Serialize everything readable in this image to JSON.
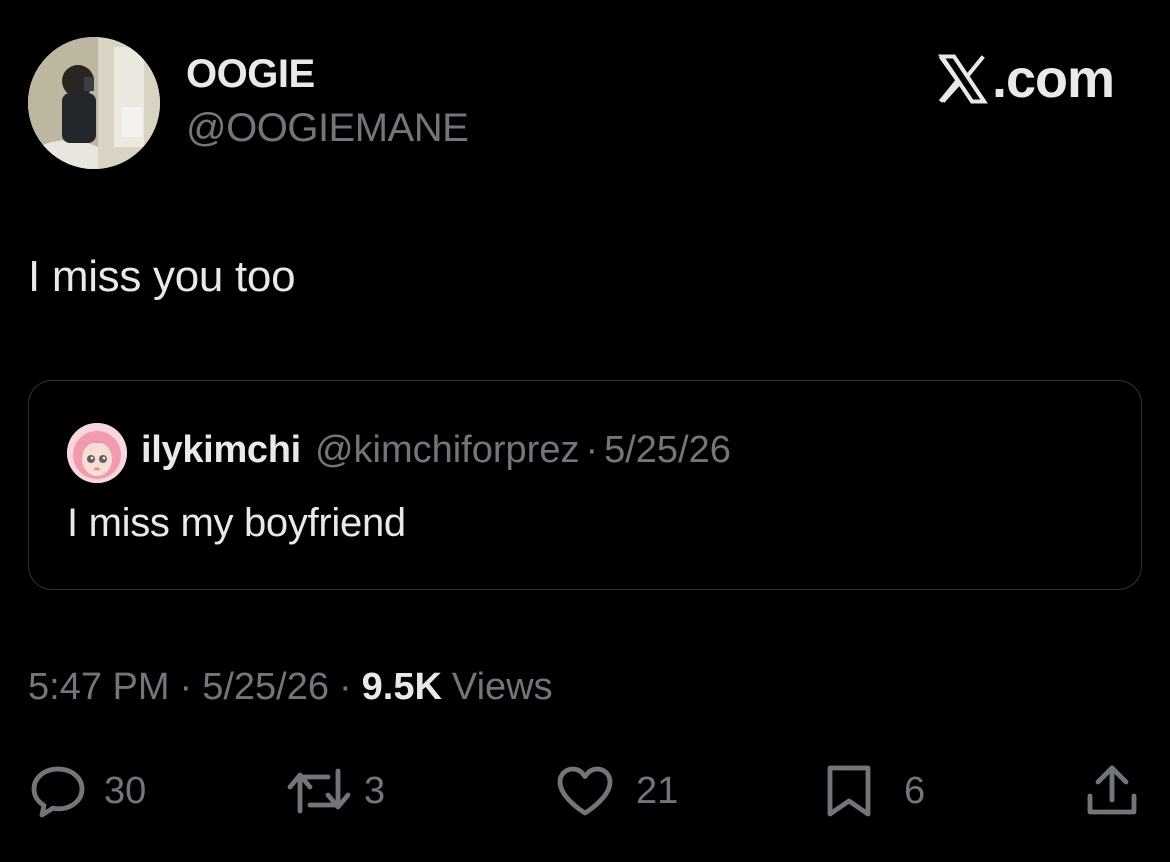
{
  "header": {
    "display_name": "OOGIE",
    "handle": "@OOGIEMANE",
    "brand": ".com",
    "brand_icon": "x-logo-icon"
  },
  "tweet": {
    "text": "I miss you too"
  },
  "quoted": {
    "name": "ilykimchi",
    "handle": "@kimchiforprez",
    "separator": "·",
    "date": "5/25/26",
    "text": "I miss my boyfriend"
  },
  "meta": {
    "time": "5:47 PM",
    "separator": "·",
    "date": "5/25/26",
    "views_count": "9.5K",
    "views_label": "Views"
  },
  "actions": {
    "replies": "30",
    "reposts": "3",
    "likes": "21",
    "bookmarks": "6"
  },
  "colors": {
    "background": "#000000",
    "primary_text": "#e7e9ea",
    "secondary_text": "#71767b",
    "border": "#2f3336"
  }
}
